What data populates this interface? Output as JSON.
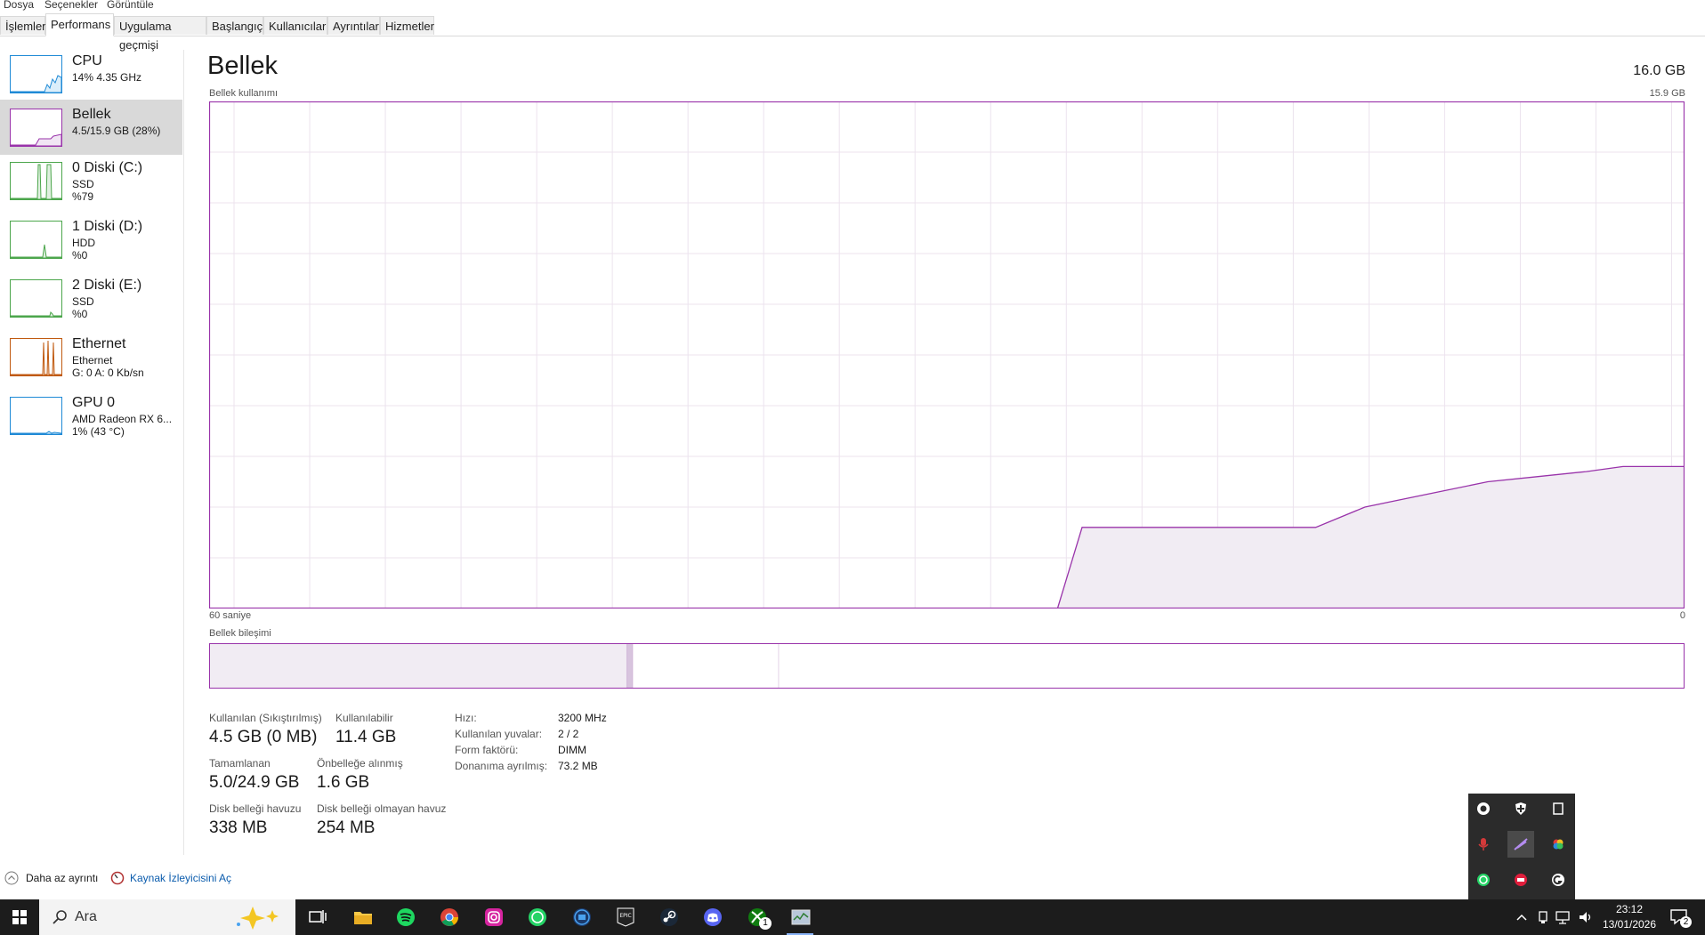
{
  "menu": [
    "Dosya",
    "Seçenekler",
    "Görüntüle"
  ],
  "tabs": [
    "İşlemler",
    "Performans",
    "Uygulama geçmişi",
    "Başlangıç",
    "Kullanıcılar",
    "Ayrıntılar",
    "Hizmetler"
  ],
  "active_tab": "Performans",
  "sidebar": [
    {
      "title": "CPU",
      "line2": "14% 4.35 GHz",
      "line3": "",
      "color": "#1f8ad6"
    },
    {
      "title": "Bellek",
      "line2": "4.5/15.9 GB (28%)",
      "line3": "",
      "color": "#9933aa",
      "selected": true
    },
    {
      "title": "0 Diski (C:)",
      "line2": "SSD",
      "line3": "%79",
      "color": "#4ca64c"
    },
    {
      "title": "1 Diski (D:)",
      "line2": "HDD",
      "line3": "%0",
      "color": "#4ca64c"
    },
    {
      "title": "2 Diski (E:)",
      "line2": "SSD",
      "line3": "%0",
      "color": "#4ca64c"
    },
    {
      "title": "Ethernet",
      "line2": "Ethernet",
      "line3": "G: 0 A: 0 Kb/sn",
      "color": "#c05a10"
    },
    {
      "title": "GPU 0",
      "line2": "AMD Radeon RX 6...",
      "line3": "1% (43 °C)",
      "color": "#1f8ad6"
    }
  ],
  "main": {
    "title": "Bellek",
    "total": "16.0 GB",
    "usage_label": "Bellek kullanımı",
    "usage_max": "15.9 GB",
    "x_left": "60 saniye",
    "x_right": "0",
    "composition_label": "Bellek bileşimi"
  },
  "chart_data": {
    "type": "area",
    "title": "Bellek kullanımı",
    "x_unit": "seconds ago",
    "x": [
      60,
      25.5,
      24.5,
      20,
      15,
      13,
      12,
      10,
      8,
      6,
      4,
      2.5,
      1,
      0
    ],
    "values_fraction": [
      0,
      0,
      0.16,
      0.16,
      0.16,
      0.2,
      0.21,
      0.23,
      0.25,
      0.26,
      0.27,
      0.28,
      0.28,
      0.28
    ],
    "ylim": [
      0,
      15.9
    ],
    "grid": true,
    "color": "#9933aa"
  },
  "composition": [
    {
      "name": "in_use",
      "fraction": 0.283
    },
    {
      "name": "modified",
      "fraction": 0.004
    },
    {
      "name": "standby",
      "fraction": 0.099
    },
    {
      "name": "free",
      "fraction": 0.614
    }
  ],
  "stats": {
    "used_label": "Kullanılan (Sıkıştırılmış)",
    "used_value": "4.5 GB (0 MB)",
    "available_label": "Kullanılabilir",
    "available_value": "11.4 GB",
    "committed_label": "Tamamlanan",
    "committed_value": "5.0/24.9 GB",
    "cached_label": "Önbelleğe alınmış",
    "cached_value": "1.6 GB",
    "paged_label": "Disk belleği havuzu",
    "paged_value": "338 MB",
    "nonpaged_label": "Disk belleği olmayan havuz",
    "nonpaged_value": "254 MB"
  },
  "specs": [
    {
      "key": "Hızı:",
      "value": "3200 MHz"
    },
    {
      "key": "Kullanılan yuvalar:",
      "value": "2 / 2"
    },
    {
      "key": "Form faktörü:",
      "value": "DIMM"
    },
    {
      "key": "Donanıma ayrılmış:",
      "value": "73.2 MB"
    }
  ],
  "footer": {
    "less_details": "Daha az ayrıntı",
    "resource_monitor": "Kaynak İzleyicisini Aç"
  },
  "taskbar": {
    "search_placeholder": "Ara",
    "time": "23:12",
    "date": "13/01/2026",
    "notification_count": "2",
    "xbox_badge": "1",
    "apps": [
      "task-view",
      "file-explorer",
      "spotify",
      "chrome",
      "instagram",
      "whatsapp",
      "app-blue",
      "epic-games",
      "steam",
      "discord",
      "xbox",
      "task-manager"
    ]
  },
  "tray_icons": [
    "obs",
    "shield",
    "window",
    "mic",
    "feather",
    "color-wheel",
    "whatsapp",
    "red-app",
    "logitech"
  ]
}
